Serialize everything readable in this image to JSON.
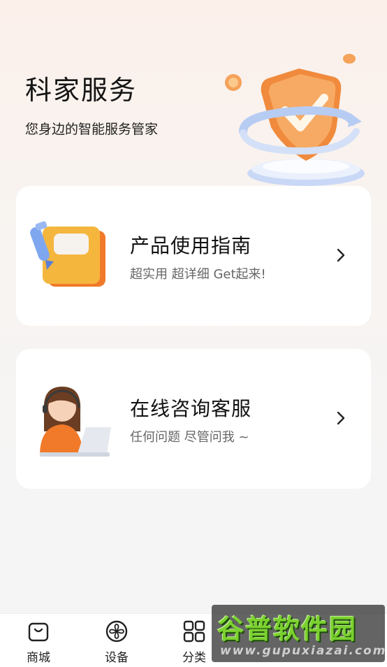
{
  "header": {
    "title": "科家服务",
    "subtitle": "您身边的智能服务管家"
  },
  "cards": [
    {
      "title": "产品使用指南",
      "desc": "超实用 超详细 Get起来!"
    },
    {
      "title": "在线咨询客服",
      "desc": "任何问题 尽管问我 ~"
    }
  ],
  "tabbar": {
    "items": [
      {
        "label": "商城",
        "icon": "shopping-bag-icon"
      },
      {
        "label": "设备",
        "icon": "fan-icon"
      },
      {
        "label": "分类",
        "icon": "grid-icon"
      }
    ]
  },
  "watermark": {
    "main": "谷普软件园",
    "sub": "www.gupuxiazai.com"
  },
  "colors": {
    "accent": "#f07a2a",
    "shield": "#f39a4a",
    "ring": "#8fb3f2"
  }
}
